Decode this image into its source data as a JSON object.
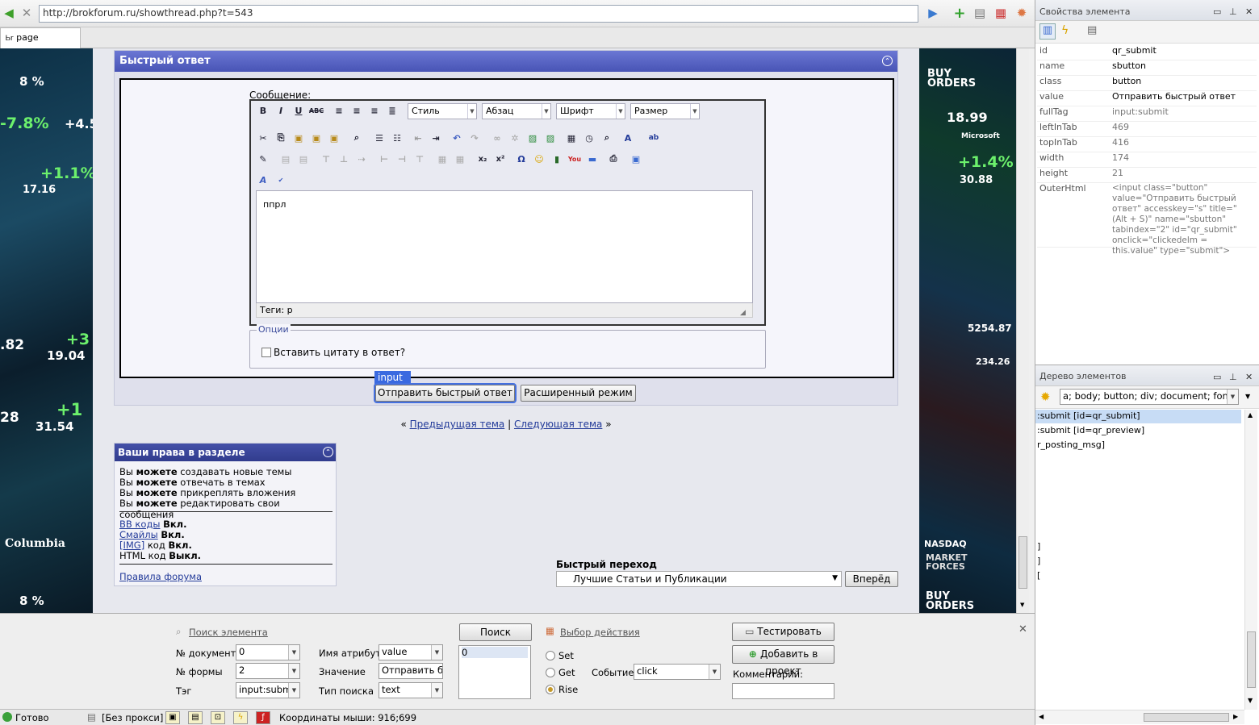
{
  "browser": {
    "url": "http://brokforum.ru/showthread.php?t=543",
    "tab_label": "page"
  },
  "quick_reply": {
    "title": "Быстрый ответ",
    "message_label": "Сообщение:",
    "style_dd": "Стиль",
    "para_dd": "Абзац",
    "font_dd": "Шрифт",
    "size_dd": "Размер",
    "editor_text": "ппрл",
    "tags_label": "Теги: p",
    "options_label": "Опции",
    "quote_label": "Вставить цитату в ответ?",
    "highlight_tag": "input",
    "submit_label": "Отправить быстрый ответ",
    "advanced_label": "Расширенный режим"
  },
  "nav": {
    "prev_symbol": "«",
    "prev": "Предыдущая тема",
    "separator": "|",
    "next": "Следующая тема",
    "next_symbol": "»"
  },
  "rights": {
    "title": "Ваши права в разделе",
    "lines": [
      {
        "pre": "Вы ",
        "bold": "можете",
        "post": " создавать новые темы"
      },
      {
        "pre": "Вы ",
        "bold": "можете",
        "post": " отвечать в темах"
      },
      {
        "pre": "Вы ",
        "bold": "можете",
        "post": " прикреплять вложения"
      },
      {
        "pre": "Вы ",
        "bold": "можете",
        "post": " редактировать свои сообщения"
      }
    ],
    "codes": [
      {
        "link": "BB коды",
        "mid": "",
        "state": "Вкл."
      },
      {
        "link": "Смайлы",
        "mid": "",
        "state": "Вкл."
      },
      {
        "link": "[IMG]",
        "mid": " код",
        "state": "Вкл."
      },
      {
        "link": "",
        "mid": "HTML код",
        "state": "Выкл."
      }
    ],
    "rules_link": "Правила форума"
  },
  "jump": {
    "label": "Быстрый переход",
    "selected": "Лучшие Статьи и Публикации",
    "go_label": "Вперёд"
  },
  "tickers": {
    "left": [
      "8 %",
      "-7.8%",
      "+4.5",
      "+1.1%",
      "17.16",
      "+3",
      ".82",
      "19.04",
      "+1",
      "28",
      "31.54",
      "Columbia",
      "8 %"
    ],
    "right": [
      "BUY ORDERS",
      "18.99",
      "Microsoft",
      "+1.4%",
      "30.88",
      "5254.87",
      "234.26",
      "NASDAQ",
      "MARKET FORCES",
      "BUY ORDERS"
    ]
  },
  "finder": {
    "search_link": "Поиск элемента",
    "doc_label": "№ документа",
    "doc_value": "0",
    "form_label": "№ формы",
    "form_value": "2",
    "tag_label": "Тэг",
    "tag_value": "input:submit",
    "attr_label": "Имя атрибута",
    "attr_value": "value",
    "val_label": "Значение",
    "val_value": "Отправить быс",
    "type_label": "Тип поиска",
    "type_value": "text",
    "search_button": "Поиск",
    "result_value": "0",
    "action_link": "Выбор действия",
    "set_label": "Set",
    "get_label": "Get",
    "rise_label": "Rise",
    "event_label": "Событие",
    "event_value": "click",
    "test_button": "Тестировать",
    "add_button": "Добавить в проект",
    "comment_label": "Комментарий:"
  },
  "status": {
    "ready": "Готово",
    "proxy": "[Без прокси]",
    "coords": "Координаты мыши: 916;699"
  },
  "properties": {
    "title": "Свойства элемента",
    "rows": [
      {
        "k": "id",
        "v": "qr_submit"
      },
      {
        "k": "name",
        "v": "sbutton"
      },
      {
        "k": "class",
        "v": "button"
      },
      {
        "k": "value",
        "v": "Отправить быстрый ответ"
      },
      {
        "k": "fullTag",
        "v": "input:submit"
      },
      {
        "k": "leftInTab",
        "v": "469"
      },
      {
        "k": "topInTab",
        "v": "416"
      },
      {
        "k": "width",
        "v": "174"
      },
      {
        "k": "height",
        "v": "21"
      }
    ],
    "outer_key": "OuterHtml",
    "outer_html": "<input class=\"button\" value=\"Отправить быстрый ответ\" accesskey=\"s\" title=\"(Alt + S)\" name=\"sbutton\" tabindex=\"2\" id=\"qr_submit\" onclick=\"clickedelm = this.value\" type=\"submit\">"
  },
  "tree": {
    "title": "Дерево элементов",
    "filter": "a; body; button; div; document; font; ...",
    "items": [
      ":submit [id=qr_submit]",
      ":submit [id=qr_preview]",
      "r_posting_msg]",
      "]",
      "]",
      "["
    ]
  },
  "colors": {
    "accent": "#4854b5",
    "link": "#223a99",
    "selection": "#c7dcf5"
  }
}
